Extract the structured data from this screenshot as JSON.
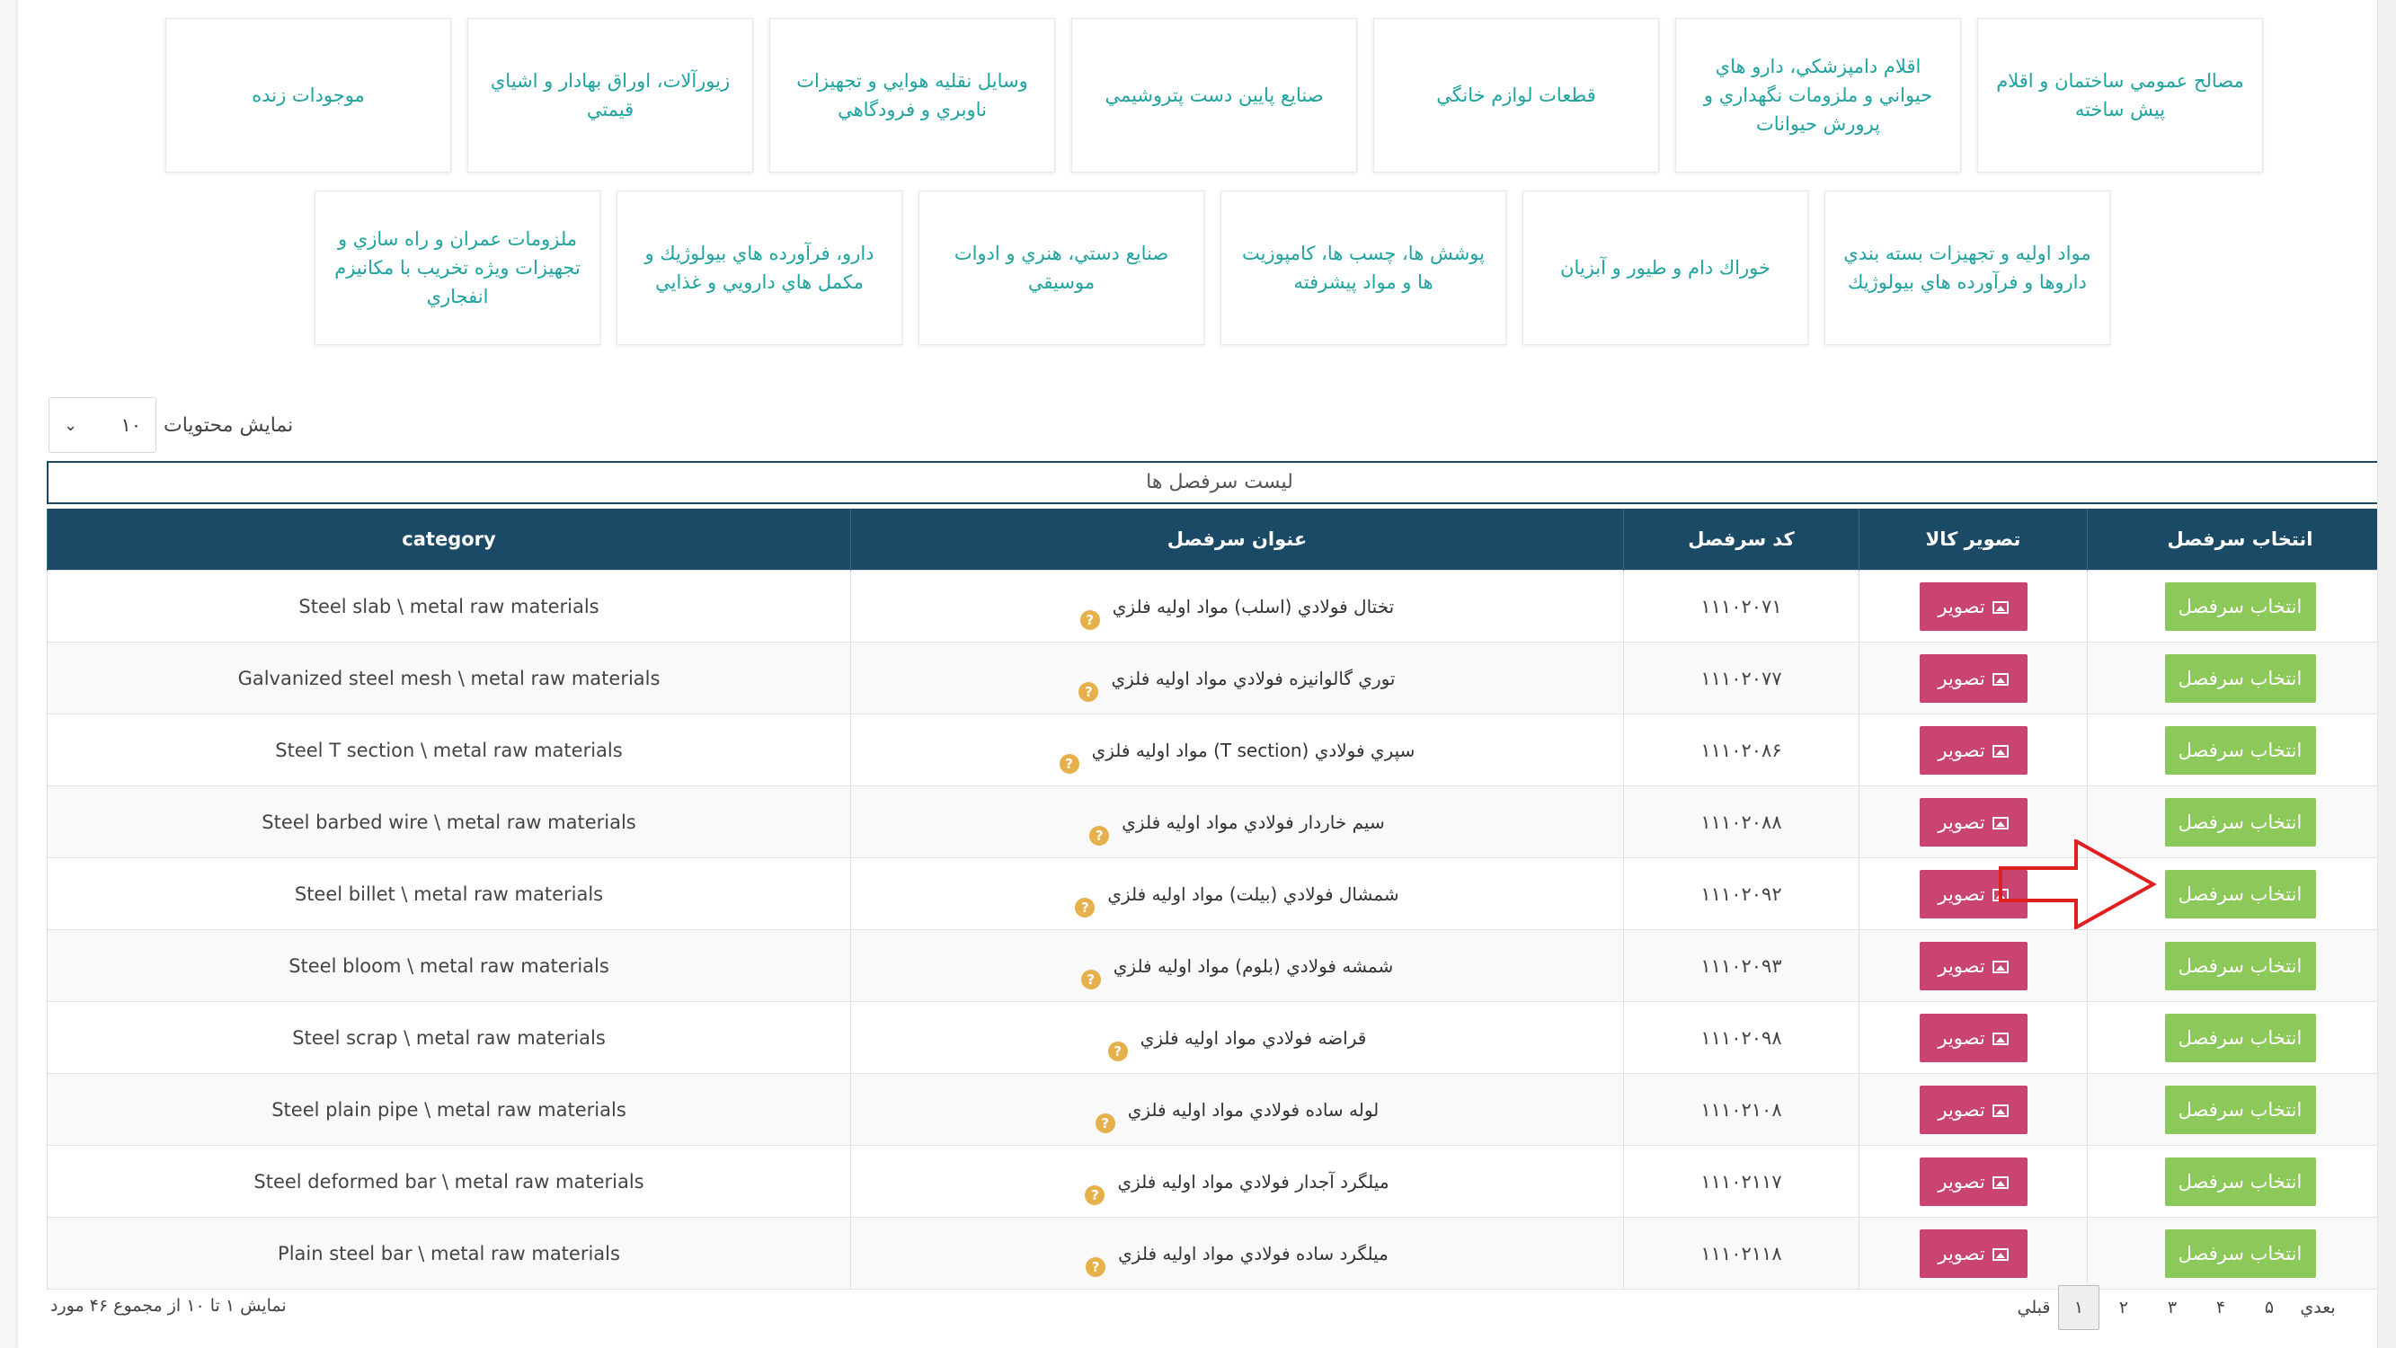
{
  "categories_row1": [
    "مصالح عمومي ساختمان و اقلام پيش ساخته",
    "اقلام دامپزشكي، دارو هاي حيواني و ملزومات نگهداري و پرورش حيوانات",
    "قطعات لوازم خانگي",
    "صنايع پايين دست پتروشيمي",
    "وسايل نقليه هوايي و تجهيزات ناوبري و فرودگاهي",
    "زيورآلات، اوراق بهادار و اشياي قيمتي",
    "موجودات زنده"
  ],
  "categories_row2": [
    "مواد اوليه و تجهيزات بسته بندي داروها و فرآورده هاي بيولوژيك",
    "خوراك دام و طيور و آبزيان",
    "پوشش ها، چسب ها، كامپوزيت ها و مواد پيشرفته",
    "صنايع دستي، هنري و ادوات موسيقي",
    "دارو، فرآورده هاي بيولوژيك و مكمل هاي دارويي و غذايي",
    "ملزومات عمران و راه سازي و تجهيزات ويژه تخريب با مكانيزم انفجاري"
  ],
  "length_menu": {
    "label": "نمايش محتويات",
    "value": "۱۰"
  },
  "table": {
    "caption": "ليست سرفصل ها",
    "headers": {
      "select": "انتخاب سرفصل",
      "image": "تصوير كالا",
      "code": "كد سرفصل",
      "title": "عنوان سرفصل",
      "category": "category"
    },
    "select_label": "انتخاب سرفصل",
    "image_label": "تصوير",
    "help_glyph": "?",
    "rows": [
      {
        "code": "۱۱۱۰۲۰۷۱",
        "title": "تختال فولادي (اسلب) مواد اوليه فلزي",
        "category": "Steel slab \\ metal raw materials"
      },
      {
        "code": "۱۱۱۰۲۰۷۷",
        "title": "توري گالوانيزه فولادي مواد اوليه فلزي",
        "category": "Galvanized steel mesh \\ metal raw materials"
      },
      {
        "code": "۱۱۱۰۲۰۸۶",
        "title": "سپري فولادي (T section) مواد اوليه فلزي",
        "category": "Steel T section \\ metal raw materials"
      },
      {
        "code": "۱۱۱۰۲۰۸۸",
        "title": "سيم خاردار فولادي مواد اوليه فلزي",
        "category": "Steel barbed wire \\ metal raw materials"
      },
      {
        "code": "۱۱۱۰۲۰۹۲",
        "title": "شمشال فولادي (بيلت) مواد اوليه فلزي",
        "category": "Steel billet \\ metal raw materials"
      },
      {
        "code": "۱۱۱۰۲۰۹۳",
        "title": "شمشه فولادي (بلوم) مواد اوليه فلزي",
        "category": "Steel bloom \\ metal raw materials"
      },
      {
        "code": "۱۱۱۰۲۰۹۸",
        "title": "قراضه فولادي مواد اوليه فلزي",
        "category": "Steel scrap \\ metal raw materials"
      },
      {
        "code": "۱۱۱۰۲۱۰۸",
        "title": "لوله ساده فولادي مواد اوليه فلزي",
        "category": "Steel plain pipe \\ metal raw materials"
      },
      {
        "code": "۱۱۱۰۲۱۱۷",
        "title": "ميلگرد آجدار فولادي مواد اوليه فلزي",
        "category": "Steel deformed bar \\ metal raw materials"
      },
      {
        "code": "۱۱۱۰۲۱۱۸",
        "title": "ميلگرد ساده فولادي مواد اوليه فلزي",
        "category": "Plain steel bar \\ metal raw materials"
      }
    ]
  },
  "footer": {
    "info": "نمايش ۱ تا ۱۰ از مجموع ۴۶ مورد"
  },
  "pagination": {
    "previous": "قبلي",
    "pages": [
      "۱",
      "۲",
      "۳",
      "۴",
      "۵"
    ],
    "next": "بعدي",
    "active": "۱"
  },
  "colors": {
    "header_bg": "#1a4a66",
    "select_button": "#8dc85a",
    "image_button": "#c9446f",
    "category_link": "#1fa3a0",
    "arrow": "#e02020"
  }
}
